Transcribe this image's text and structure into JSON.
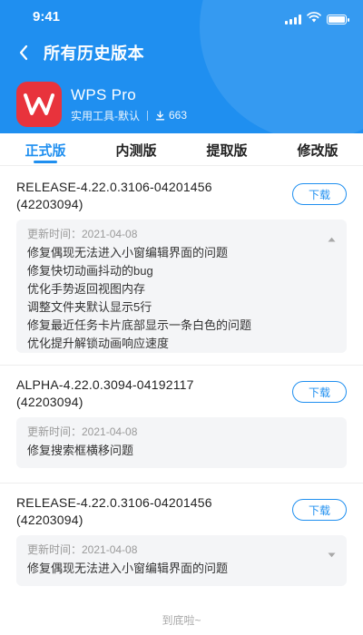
{
  "status_bar": {
    "time": "9:41"
  },
  "nav": {
    "title": "所有历史版本"
  },
  "app": {
    "name": "WPS Pro",
    "category": "实用工具-默认",
    "downloads": "663"
  },
  "tabs": [
    {
      "label": "正式版",
      "active": true
    },
    {
      "label": "内测版",
      "active": false
    },
    {
      "label": "提取版",
      "active": false
    },
    {
      "label": "修改版",
      "active": false
    }
  ],
  "versions": [
    {
      "name": "RELEASE-4.22.0.3106-04201456",
      "build": "(42203094)",
      "download_label": "下载",
      "update_time": "更新时间：2021-04-08",
      "expanded": true,
      "notes": [
        "修复偶现无法进入小窗编辑界面的问题",
        "修复快切动画抖动的bug",
        "优化手势返回视图内存",
        "调整文件夹默认显示5行",
        "修复最近任务卡片底部显示一条白色的问题",
        "优化提升解锁动画响应速度"
      ]
    },
    {
      "name": "ALPHA-4.22.0.3094-04192117",
      "build": "(42203094)",
      "download_label": "下载",
      "update_time": "更新时间：2021-04-08",
      "notes": [
        "修复搜索框横移问题"
      ]
    },
    {
      "name": "RELEASE-4.22.0.3106-04201456",
      "build": "(42203094)",
      "download_label": "下载",
      "update_time": "更新时间：2021-04-08",
      "expanded": false,
      "notes": [
        "修复偶现无法进入小窗编辑界面的问题"
      ]
    }
  ],
  "footer": {
    "text": "到底啦~"
  },
  "colors": {
    "accent": "#1f8ff0",
    "logo_bg": "#e8333c",
    "notes_bg": "#f4f5f7"
  },
  "icons": {
    "back": "chevron-left-icon",
    "download": "download-icon",
    "expand": "caret-up-icon",
    "collapse": "caret-down-icon"
  }
}
